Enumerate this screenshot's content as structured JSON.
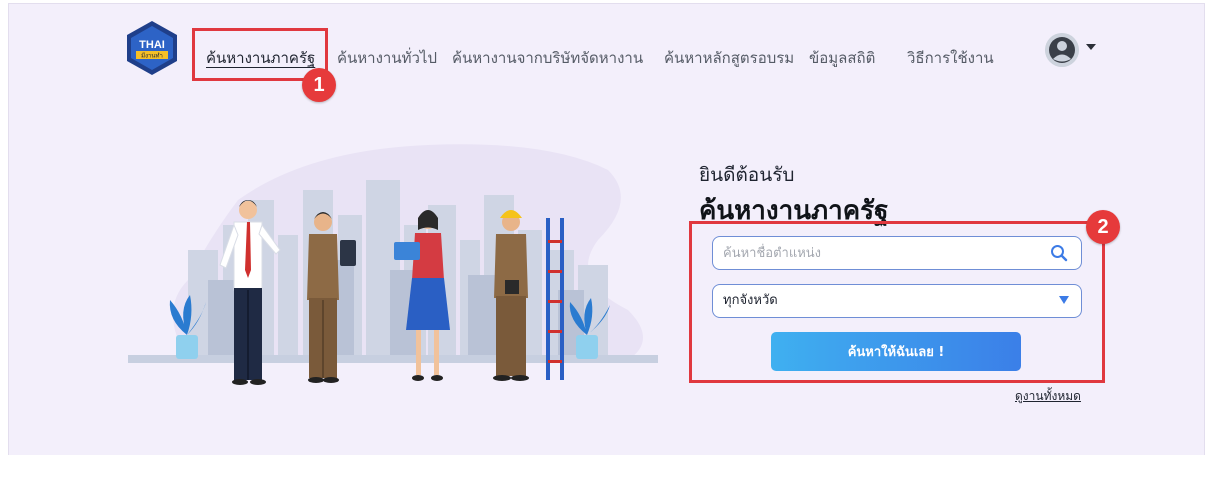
{
  "logo": {
    "text_top": "THAI",
    "text_bottom": "มีงานทำ"
  },
  "nav": {
    "items": [
      {
        "label": "ค้นหางานภาครัฐ",
        "active": true
      },
      {
        "label": "ค้นหางานทั่วไป"
      },
      {
        "label": "ค้นหางานจากบริษัทจัดหางาน"
      },
      {
        "label": "ค้นหาหลักสูตรอบรม"
      },
      {
        "label": "ข้อมูลสถิติ"
      },
      {
        "label": "วิธีการใช้งาน"
      }
    ]
  },
  "user": {
    "icon": "user-avatar-icon"
  },
  "hero": {
    "welcome": "ยินดีต้อนรับ",
    "title": "ค้นหางานภาครัฐ",
    "search": {
      "placeholder": "ค้นหาชื่อตำแหน่ง",
      "value": "",
      "icon": "search-icon"
    },
    "province_select": {
      "selected": "ทุกจังหวัด"
    },
    "submit_label": "ค้นหาให้ฉันเลย !",
    "view_all_label": "ดูงานทั้งหมด"
  },
  "annotations": [
    {
      "number": "1"
    },
    {
      "number": "2"
    }
  ],
  "colors": {
    "page_background": "#f3effb",
    "accent_blue": "#3b7fe8",
    "annotation_red": "#e0383f"
  }
}
